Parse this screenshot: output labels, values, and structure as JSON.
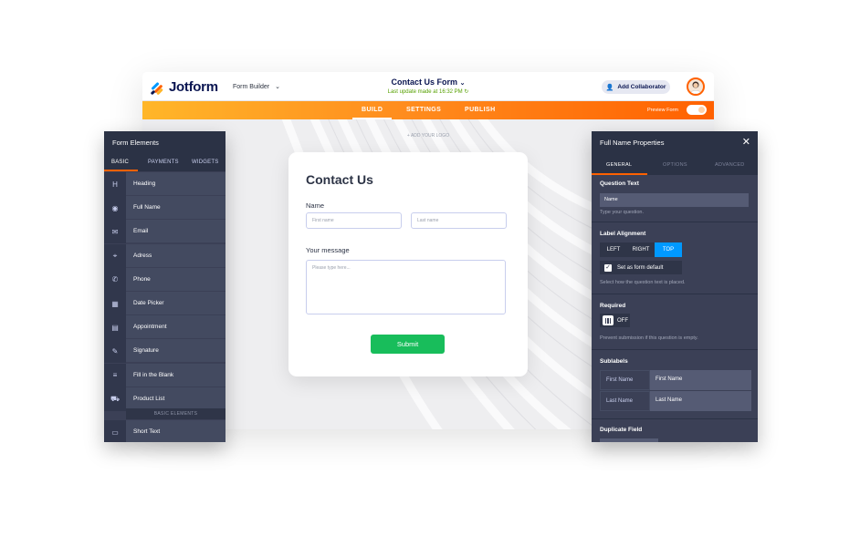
{
  "colors": {
    "brand_orange": "#ff6100",
    "panel_dark": "#2b3245",
    "submit_green": "#18bd5b",
    "active_blue": "#0099ff"
  },
  "topbar": {
    "logo_text": "Jotform",
    "builder_label": "Form Builder",
    "form_title": "Contact Us Form",
    "last_update": "Last update made at 16:32 PM",
    "collaborator_label": "Add Collaborator",
    "avatar_icon": "user-avatar"
  },
  "nav": {
    "tabs": [
      "BUILD",
      "SETTINGS",
      "PUBLISH"
    ],
    "active_tab": "BUILD",
    "preview_label": "Preview Form"
  },
  "canvas": {
    "add_logo": "+ ADD YOUR LOGO"
  },
  "form": {
    "heading": "Contact Us",
    "name_label": "Name",
    "first_name_placeholder": "First name",
    "last_name_placeholder": "Last name",
    "message_label": "Your message",
    "message_placeholder": "Please type here...",
    "submit_label": "Submit"
  },
  "left_panel": {
    "title": "Form Elements",
    "tabs": [
      "BASIC",
      "PAYMENTS",
      "WIDGETS"
    ],
    "items": [
      {
        "label": "Heading",
        "icon": "heading-icon",
        "glyph": "H"
      },
      {
        "label": "Full Name",
        "icon": "user-icon",
        "glyph": "◉"
      },
      {
        "label": "Email",
        "icon": "email-icon",
        "glyph": "✉"
      },
      {
        "label": "Adress",
        "icon": "location-icon",
        "glyph": "⌖"
      },
      {
        "label": "Phone",
        "icon": "phone-icon",
        "glyph": "✆"
      },
      {
        "label": "Date Picker",
        "icon": "calendar-icon",
        "glyph": "▦"
      },
      {
        "label": "Appointment",
        "icon": "appointment-icon",
        "glyph": "▤"
      },
      {
        "label": "Signature",
        "icon": "signature-icon",
        "glyph": "✎"
      },
      {
        "label": "Fill in the Blank",
        "icon": "fill-blank-icon",
        "glyph": "≡"
      },
      {
        "label": "Product List",
        "icon": "cart-icon",
        "glyph": "⛟"
      }
    ],
    "section_label": "BASIC ELEMENTS",
    "extra_item": {
      "label": "Short Text",
      "icon": "short-text-icon",
      "glyph": "▭"
    }
  },
  "right_panel": {
    "title": "Full Name Properties",
    "tabs": [
      "GENERAL",
      "OPTIONS",
      "ADVANCED"
    ],
    "question_text_label": "Question Text",
    "question_text_value": "Name",
    "question_text_hint": "Type your question.",
    "label_alignment_label": "Label Alignment",
    "alignment_options": [
      "LEFT",
      "RIGHT",
      "TOP"
    ],
    "alignment_selected": "TOP",
    "set_default_label": "Set as form default",
    "alignment_hint": "Select how the question text is placed.",
    "required_label": "Required",
    "required_state": "OFF",
    "required_hint": "Prevent submission if this question is empty.",
    "sublabels_label": "Sublabels",
    "sublabels": [
      {
        "key": "First Name",
        "value": "First Name"
      },
      {
        "key": "Last Name",
        "value": "Last Name"
      }
    ],
    "duplicate_label": "Duplicate Field"
  }
}
